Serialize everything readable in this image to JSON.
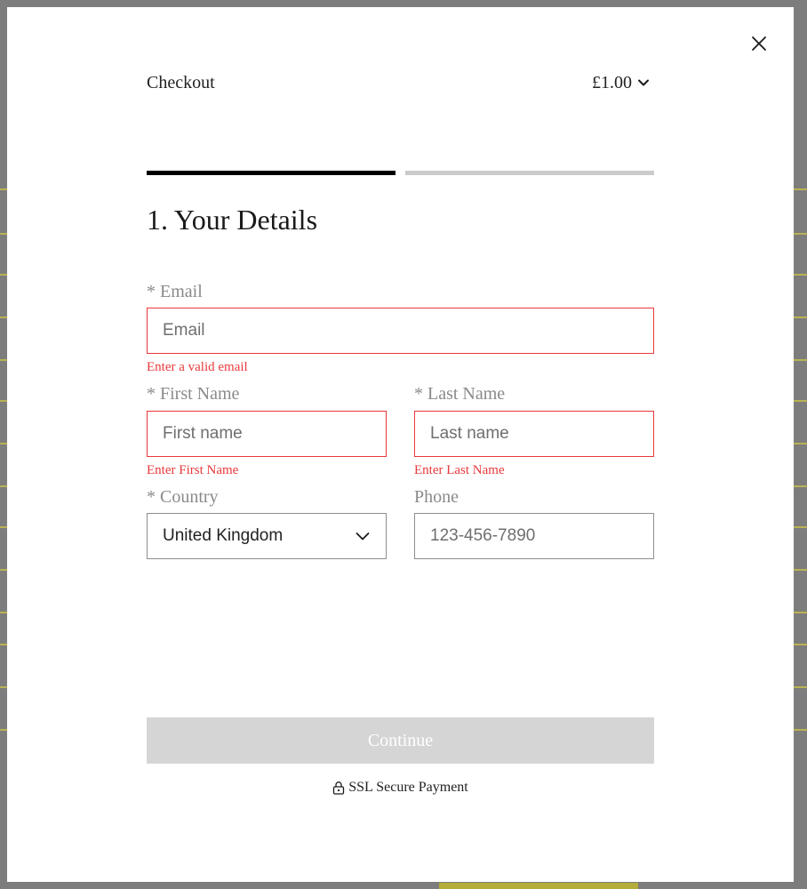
{
  "modal": {
    "title": "Checkout",
    "price": "£1.00",
    "step_title": "1. Your Details",
    "colors": {
      "error": "#e8393a",
      "progress_active": "#000000",
      "progress_inactive": "#cbcbcb",
      "button_disabled": "#d5d5d5"
    },
    "icons": {
      "close": "close-icon",
      "price_toggle": "chevron-down-icon",
      "country_select": "chevron-down-icon",
      "ssl": "lock-icon"
    },
    "progress": {
      "current_step": 1,
      "total_steps": 2
    }
  },
  "form": {
    "email": {
      "label": "* Email",
      "placeholder": "Email",
      "error": "Enter a valid email"
    },
    "first_name": {
      "label": "* First Name",
      "placeholder": "First name",
      "error": "Enter First Name"
    },
    "last_name": {
      "label": "* Last Name",
      "placeholder": "Last name",
      "error": "Enter Last Name"
    },
    "country": {
      "label": "* Country",
      "value": "United Kingdom"
    },
    "phone": {
      "label": "Phone",
      "placeholder": "123-456-7890"
    }
  },
  "actions": {
    "continue_label": "Continue",
    "secure_label": "SSL Secure Payment"
  }
}
